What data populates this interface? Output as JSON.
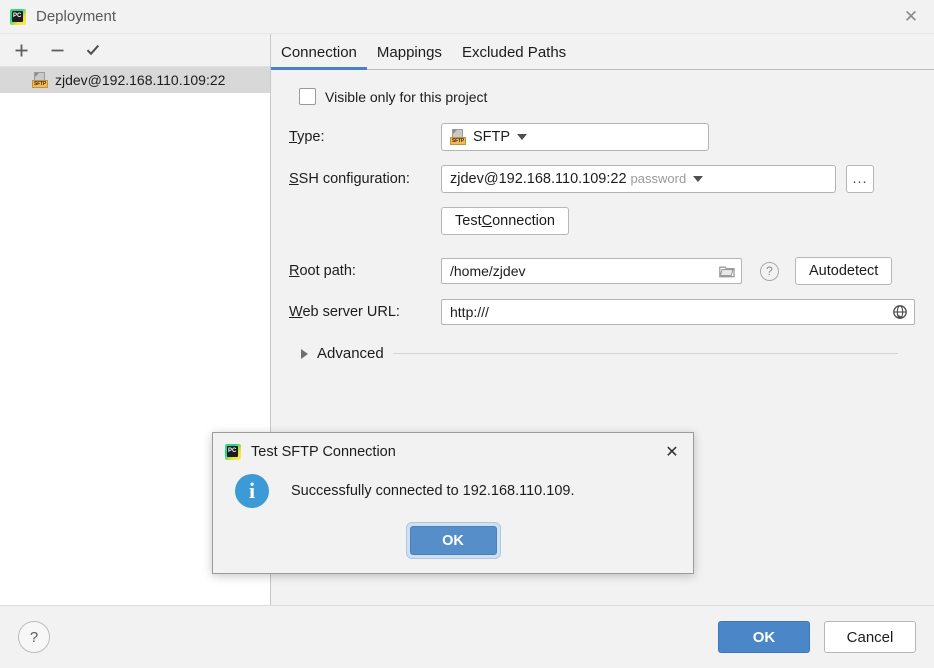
{
  "window": {
    "title": "Deployment",
    "app_icon": "pycharm-icon",
    "close_icon": "✕"
  },
  "sidebar": {
    "toolbar": [
      {
        "name": "add-server-button",
        "glyph": "+"
      },
      {
        "name": "remove-server-button",
        "glyph": "−"
      },
      {
        "name": "set-default-server-button",
        "glyph": "✓"
      }
    ],
    "items": [
      {
        "label": "zjdev@192.168.110.109:22",
        "icon": "sftp-icon",
        "selected": true
      }
    ]
  },
  "tabs": [
    {
      "label": "Connection",
      "active": true
    },
    {
      "label": "Mappings",
      "active": false
    },
    {
      "label": "Excluded Paths",
      "active": false
    }
  ],
  "form": {
    "visible_only": {
      "label": "Visible only for this project",
      "checked": false
    },
    "type": {
      "label_mnemonic": "T",
      "label_rest": "ype:",
      "value": "SFTP",
      "icon": "sftp-icon"
    },
    "ssh_configuration": {
      "label_mnemonic": "S",
      "label_rest": "SH configuration:",
      "value": "zjdev@192.168.110.109:22",
      "value_suffix": "password",
      "browse_label": "..."
    },
    "test_connection": {
      "prefix": "Test ",
      "mnemonic": "C",
      "suffix": "onnection"
    },
    "root_path": {
      "label_mnemonic": "R",
      "label_rest": "oot path:",
      "value": "/home/zjdev",
      "folder_icon": "folder-icon",
      "help_icon": "?",
      "autodetect_label": "Autodetect"
    },
    "web_server_url": {
      "label_mnemonic": "W",
      "label_rest": "eb server URL:",
      "value": "http:///",
      "globe_icon": "globe-icon"
    },
    "advanced": {
      "label": "Advanced",
      "expanded": false
    }
  },
  "footer": {
    "help_glyph": "?",
    "ok_label": "OK",
    "cancel_label": "Cancel"
  },
  "modal": {
    "title": "Test SFTP Connection",
    "app_icon": "pycharm-icon",
    "close_icon": "✕",
    "info_glyph": "i",
    "message": "Successfully connected to 192.168.110.109.",
    "ok_label": "OK"
  },
  "colors": {
    "accent": "#4a80c8",
    "primary_button": "#4a86c8",
    "info": "#3c9ad6",
    "window_bg": "#f2f2f2",
    "selection": "#d8d8d8"
  }
}
